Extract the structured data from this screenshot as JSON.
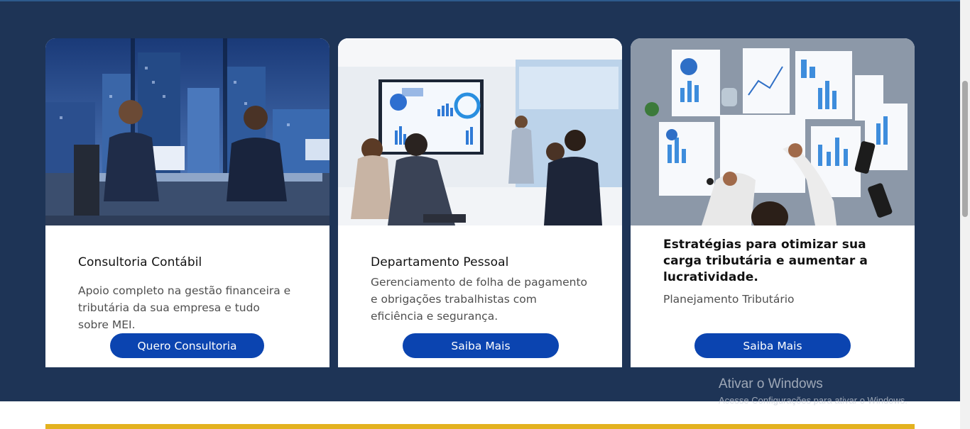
{
  "services": [
    {
      "image_icon": "office-meeting-photo",
      "title": "Consultoria Contábil",
      "description": "Apoio completo na gestão financeira e tributária da sua empresa e tudo sobre MEI.",
      "button": "Quero Consultoria"
    },
    {
      "image_icon": "presentation-photo",
      "title": "Departamento Pessoal",
      "description": "Gerenciamento de folha de pagamento e obrigações trabalhistas com eficiência e segurança.",
      "button": "Saiba Mais"
    },
    {
      "image_icon": "charts-desk-photo",
      "title": "Estratégias para otimizar sua carga tributária e aumentar a lucratividade.",
      "description": "Planejamento Tributário",
      "button": "Saiba Mais"
    }
  ],
  "watermark": {
    "line1": "Ativar o Windows",
    "line2": "Acesse Configurações para ativar o Windows."
  },
  "colors": {
    "section_bg": "#1e3456",
    "button": "#0b44b0",
    "accent_bar": "#e3b21f"
  }
}
